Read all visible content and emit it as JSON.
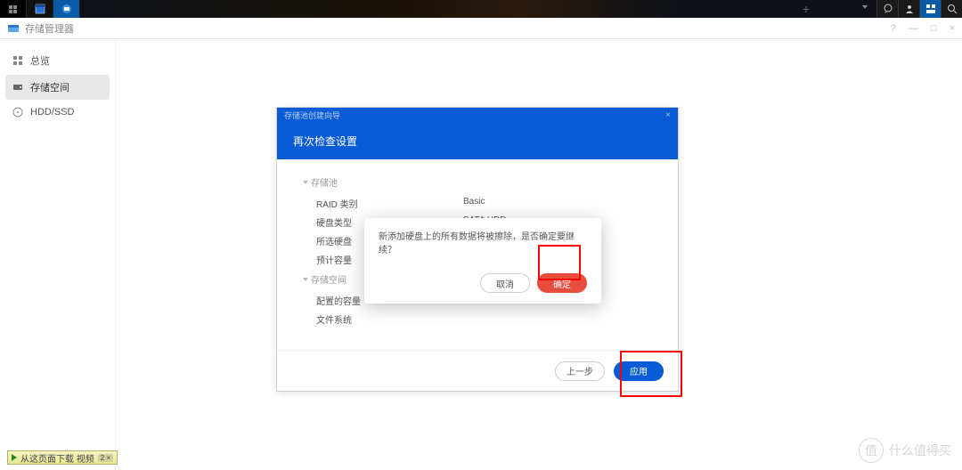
{
  "window": {
    "title": "存储管理器"
  },
  "winControls": {
    "help": "?",
    "min": "—",
    "max": "□",
    "close": "×"
  },
  "sidebar": {
    "items": [
      {
        "label": "总览"
      },
      {
        "label": "存储空间"
      },
      {
        "label": "HDD/SSD"
      }
    ]
  },
  "wizard": {
    "breadcrumb": "存储池创建向导",
    "close": "×",
    "title": "再次检查设置",
    "sections": [
      {
        "name": "存储池",
        "rows": [
          {
            "k": "RAID 类别",
            "v": "Basic"
          },
          {
            "k": "硬盘类型",
            "v": "SATA HDD"
          },
          {
            "k": "所选硬盘",
            "v": ""
          },
          {
            "k": "预计容量",
            "v": ""
          }
        ]
      },
      {
        "name": "存储空间",
        "rows": [
          {
            "k": "配置的容量",
            "v": ""
          },
          {
            "k": "文件系统",
            "v": ""
          }
        ]
      }
    ],
    "footer": {
      "back": "上一步",
      "apply": "应用"
    }
  },
  "confirm": {
    "message": "新添加硬盘上的所有数据将被擦除，是否确定要继续？",
    "cancel": "取消",
    "ok": "确定"
  },
  "download_pill": {
    "label": "从这页面下载 视频",
    "badge": "2 ×"
  },
  "watermark": {
    "glyph": "值",
    "text": "什么值得买"
  }
}
